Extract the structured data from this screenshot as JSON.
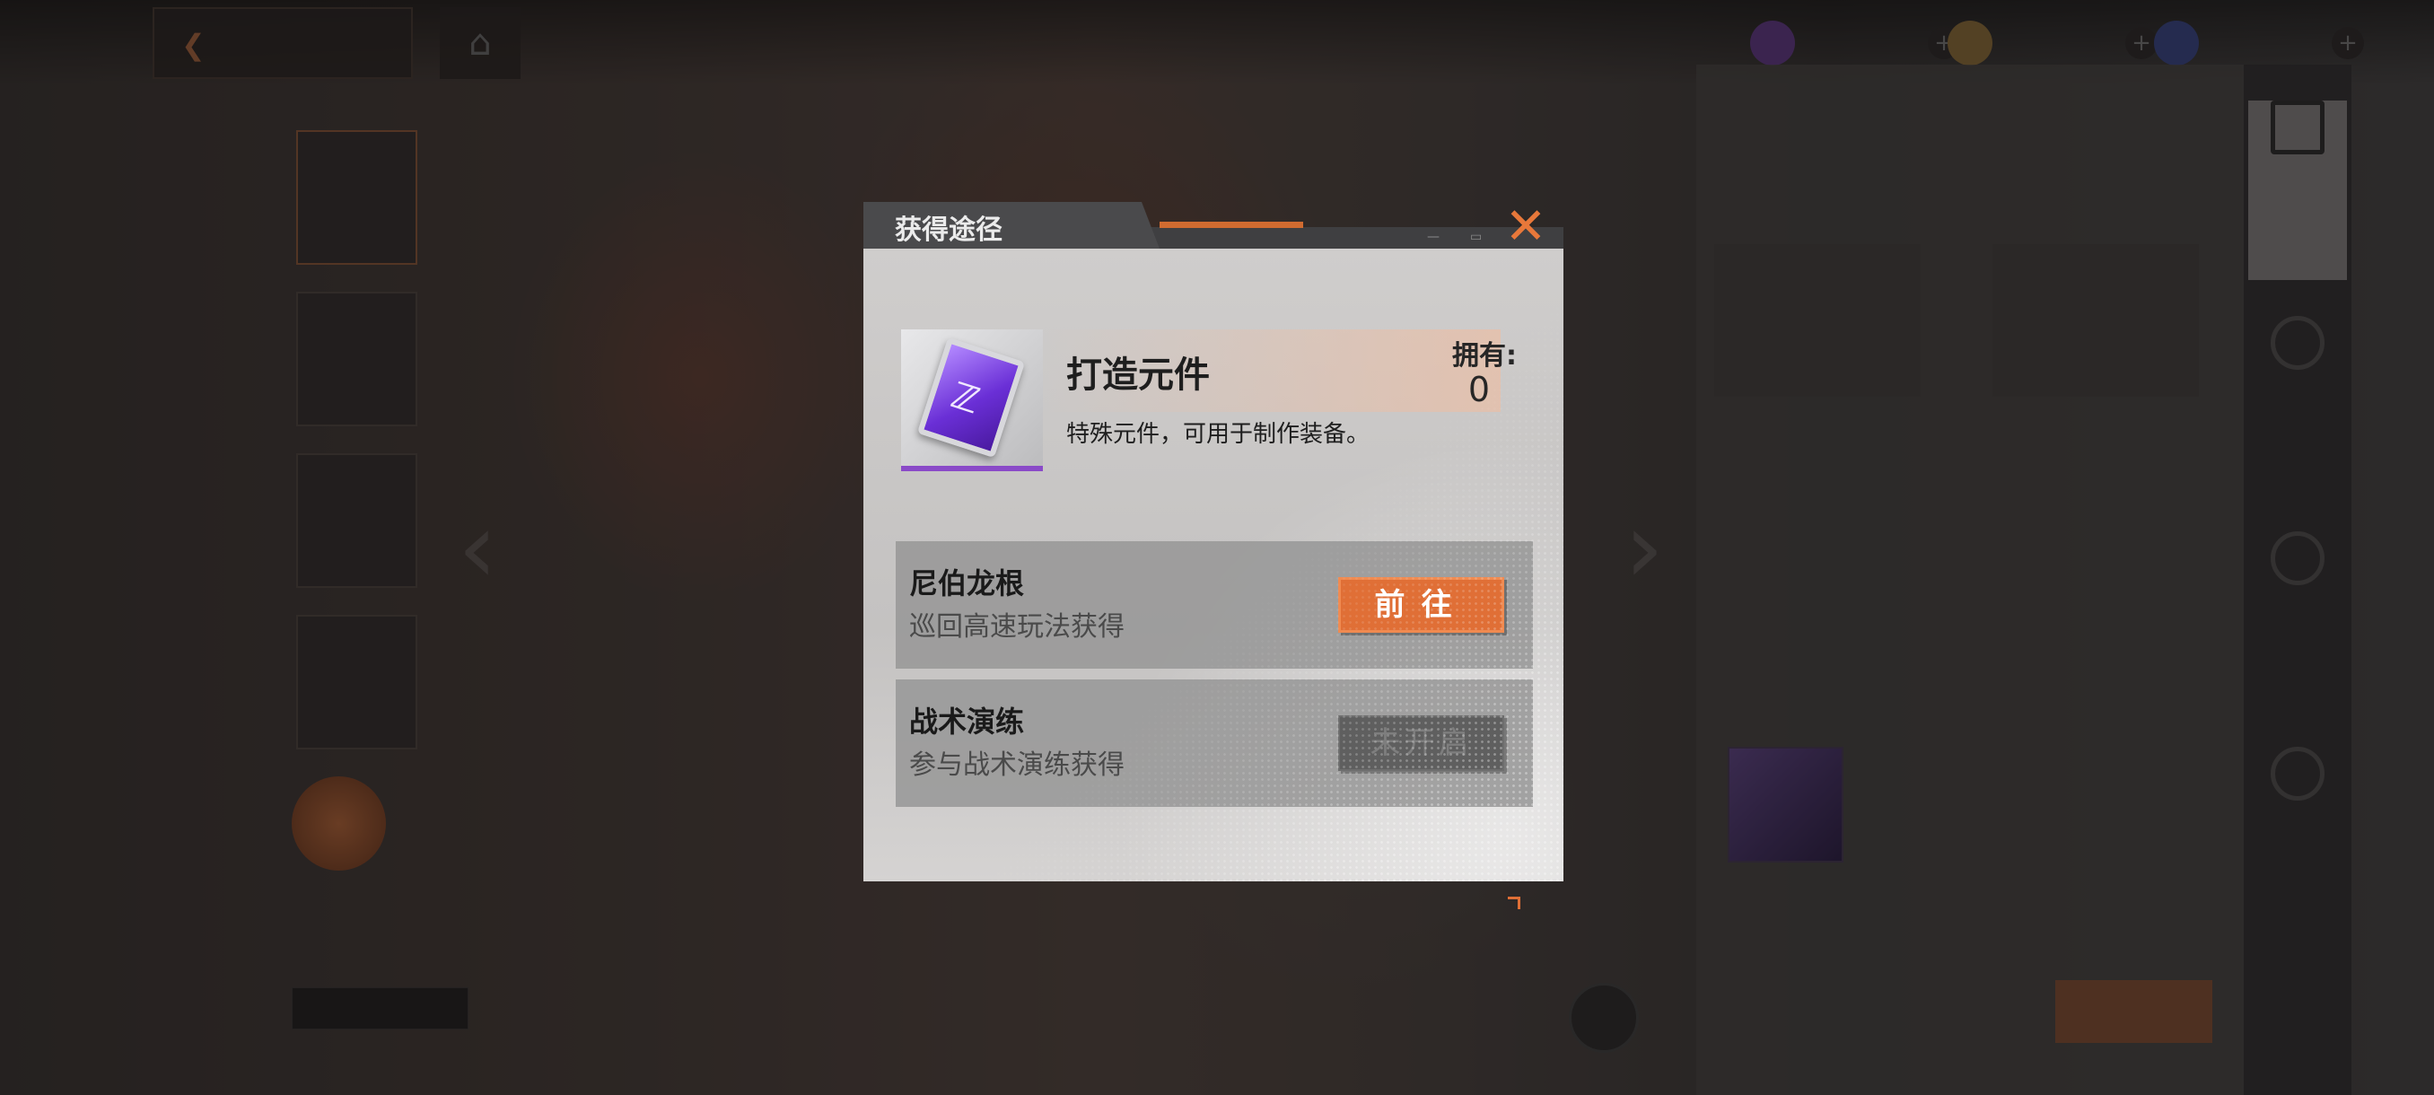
{
  "dialog": {
    "title": "获得途径",
    "close_icon": "close-icon",
    "item": {
      "name": "打造元件",
      "own_label": "拥有:",
      "own_value": "0",
      "description": "特殊元件，可用于制作装备。",
      "icon": "component-card-icon",
      "rarity_color": "#8a4ac8"
    },
    "sources": [
      {
        "name": "尼伯龙根",
        "desc": "巡回高速玩法获得",
        "button": "前往",
        "state": "available"
      },
      {
        "name": "战术演练",
        "desc": "参与战术演练获得",
        "button": "未开启",
        "state": "locked"
      }
    ]
  },
  "colors": {
    "accent": "#e06f36",
    "dialog_bg": "#cfcdcc",
    "row_bg": "#969696",
    "locked_btn": "#5f5f5f"
  }
}
